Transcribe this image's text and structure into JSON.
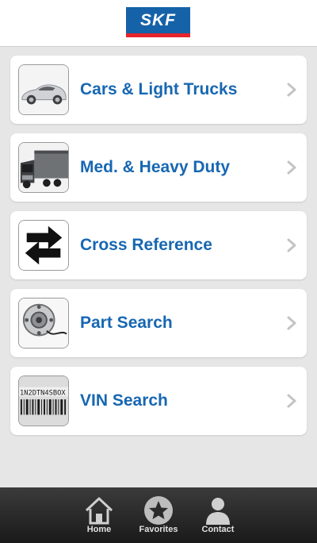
{
  "header": {
    "logo_text": "SKF"
  },
  "menu": [
    {
      "label": "Cars & Light Trucks",
      "icon": "car-icon"
    },
    {
      "label": "Med. & Heavy Duty",
      "icon": "truck-icon"
    },
    {
      "label": "Cross Reference",
      "icon": "swap-arrows-icon"
    },
    {
      "label": "Part Search",
      "icon": "wheel-hub-icon"
    },
    {
      "label": "VIN Search",
      "icon": "vin-barcode-icon"
    }
  ],
  "vin_sample": "1N2DTN4SBOX",
  "tabs": [
    {
      "label": "Home",
      "icon": "home-icon"
    },
    {
      "label": "Favorites",
      "icon": "star-icon"
    },
    {
      "label": "Contact",
      "icon": "person-icon"
    }
  ],
  "colors": {
    "brand_blue": "#1562a8",
    "brand_red": "#e6242b",
    "link_blue": "#1767b2"
  }
}
